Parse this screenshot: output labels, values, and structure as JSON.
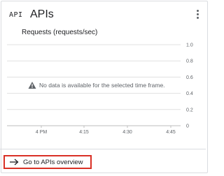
{
  "card": {
    "badge": "API",
    "title": "APIs",
    "menu_icon": "more-vert-icon"
  },
  "chart_data": {
    "type": "line",
    "title": "Requests (requests/sec)",
    "x_categories": [
      "4 PM",
      "4:15",
      "4:30",
      "4:45"
    ],
    "y_ticks": [
      "1.0",
      "0.8",
      "0.6",
      "0.4",
      "0.2",
      "0"
    ],
    "ylim": [
      0,
      1.0
    ],
    "grid": true,
    "series": []
  },
  "empty_state": {
    "icon": "warning-icon",
    "message": "No data is available for the selected time frame."
  },
  "footer": {
    "icon": "arrow-right-icon",
    "link_label": "Go to APIs overview",
    "highlight_color": "#d93025"
  }
}
